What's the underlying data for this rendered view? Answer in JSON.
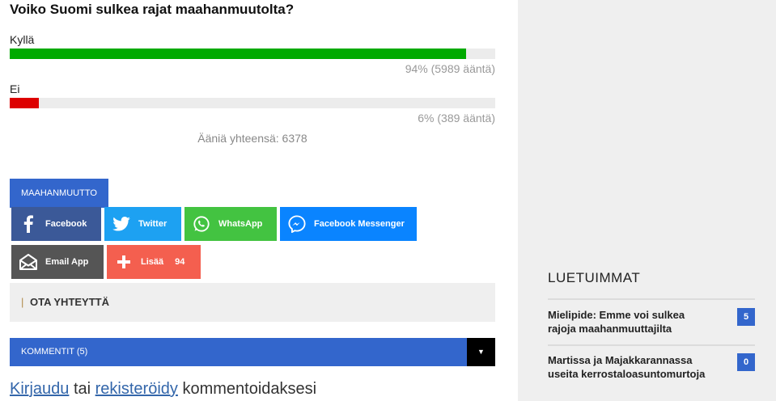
{
  "poll": {
    "question": "Voiko Suomi sulkea rajat maahanmuutolta?",
    "options": [
      {
        "label": "Kyllä",
        "result": "94% (5989 ääntä)",
        "fraction": 0.94,
        "color": "#00aa00"
      },
      {
        "label": "Ei",
        "result": "6% (389 ääntä)",
        "fraction": 0.06,
        "color": "#dd0000"
      }
    ],
    "total": "Ääniä yhteensä: 6378"
  },
  "tag": {
    "label": "MAAHANMUUTTO"
  },
  "share": {
    "facebook": {
      "label": "Facebook",
      "color": "#3b5998",
      "icon": "facebook-icon"
    },
    "twitter": {
      "label": "Twitter",
      "color": "#1da1f2",
      "icon": "twitter-icon"
    },
    "whatsapp": {
      "label": "WhatsApp",
      "color": "#43c341",
      "icon": "whatsapp-icon"
    },
    "messenger": {
      "label": "Facebook Messenger",
      "color": "#0a84ff",
      "icon": "messenger-icon"
    },
    "email": {
      "label": "Email App",
      "color": "#555555",
      "icon": "email-icon"
    },
    "more": {
      "label": "Lisää",
      "count": "94",
      "color": "#f45f4f",
      "icon": "plus-icon"
    }
  },
  "contact": {
    "pipe": "|",
    "label": "OTA YHTEYTTÄ"
  },
  "comments": {
    "label": "KOMMENTIT (5)",
    "toggle": "▼"
  },
  "login": {
    "login_link": "Kirjaudu",
    "or": "tai",
    "register_link": "rekisteröidy",
    "suffix": "kommentoidaksesi"
  },
  "sidebar": {
    "title": "LUETUIMMAT",
    "items": [
      {
        "title": "Mielipide: Emme voi sulkea rajoja maahanmuuttajilta",
        "count": "5"
      },
      {
        "title": "Martissa ja Majakkarannassa useita kerrostaloasuntomurtoja",
        "count": "0"
      }
    ]
  }
}
